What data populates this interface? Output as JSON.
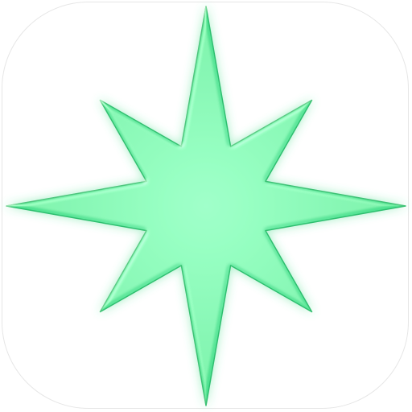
{
  "icon": {
    "name": "eight-point-star-icon",
    "background_color": "#ffffff",
    "border_color": "#e6e6e6",
    "star_color": "#3ddc84",
    "star_highlight_color": "#7ff2b3",
    "star_edge_color": "#2fbf6f",
    "glow_color": "#3ddc84"
  }
}
